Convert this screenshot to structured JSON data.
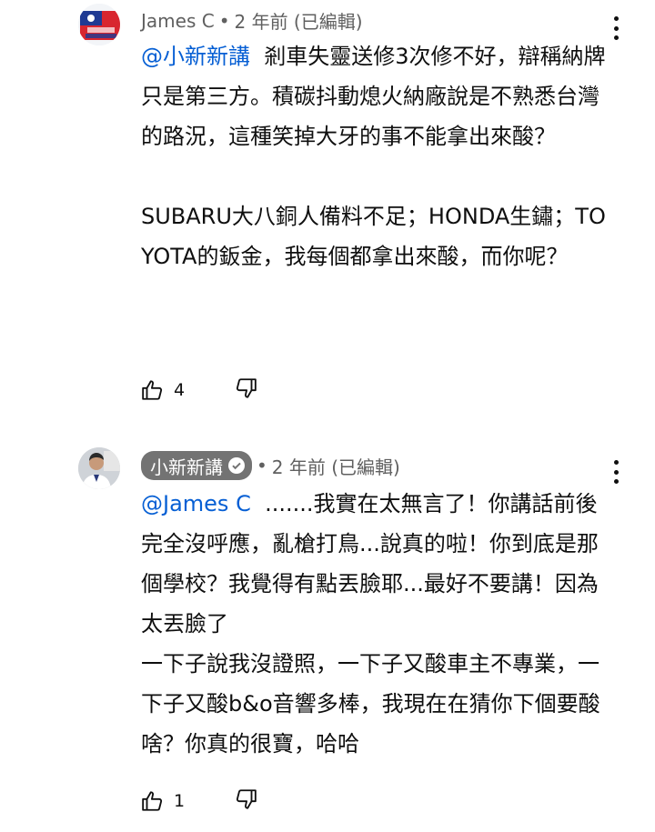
{
  "comments": [
    {
      "author": "James C",
      "dot": "•",
      "time": "2 年前 (已編輯)",
      "mention": "@小新新講",
      "text_after_mention": "  剎車失靈送修3次修不好，辯稱納牌只是第三方。積碳抖動熄火納廠說是不熟悉台灣的路況，這種笑掉大牙的事不能拿出來酸？\n\nSUBARU大八銅人備料不足；HONDA生鏽；TOYOTA的鈑金，我每個都拿出來酸，而你呢？",
      "likes": "4",
      "avatar_icon": "flag-avatar-icon"
    },
    {
      "author": "小新新講",
      "dot": "•",
      "time": "2 年前 (已編輯)",
      "mention": "@James C",
      "text_after_mention": "  .......我實在太無言了！你講話前後完全沒呼應，亂槍打鳥...說真的啦！你到底是那個學校？我覺得有點丟臉耶...最好不要講！因為太丟臉了\n一下子說我沒證照，一下子又酸車主不專業，一下子又酸b&o音響多棒，我現在在猜你下個要酸啥？你真的很寶，哈哈",
      "likes": "1",
      "avatar_icon": "person-avatar-icon"
    }
  ],
  "colors": {
    "mention": "#065fd4",
    "meta": "#606060",
    "owner_pill": "#737373"
  }
}
